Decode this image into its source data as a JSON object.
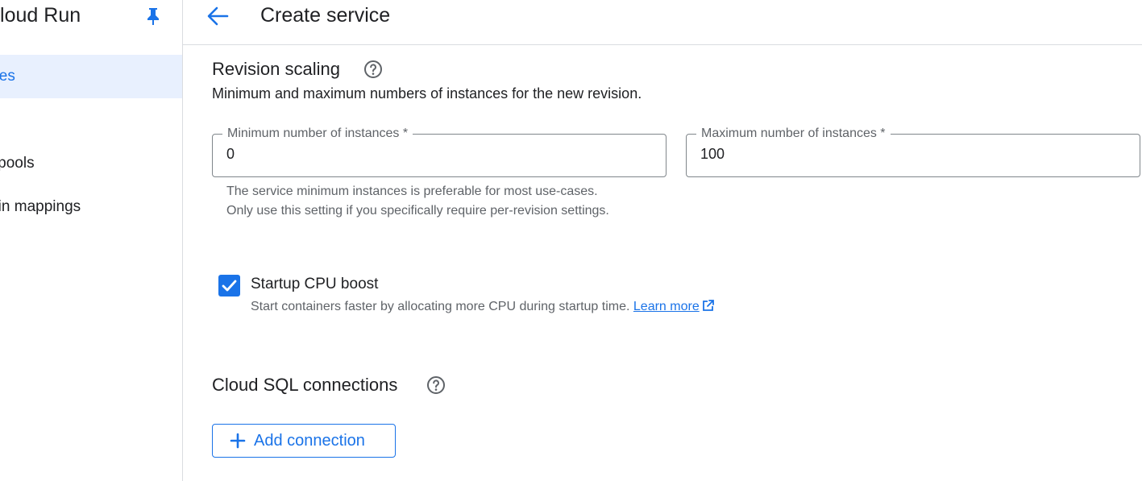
{
  "sidebar": {
    "title": "Cloud Run",
    "items": [
      {
        "label": "Services",
        "active": true
      },
      {
        "label": "Worker pools",
        "active": false
      },
      {
        "label": "Domain mappings",
        "active": false
      }
    ]
  },
  "header": {
    "title": "Create service"
  },
  "revision_scaling": {
    "title": "Revision scaling",
    "description": "Minimum and maximum numbers of instances for the new revision.",
    "min_field": {
      "label": "Minimum number of instances *",
      "value": "0"
    },
    "max_field": {
      "label": "Maximum number of instances *",
      "value": "100"
    },
    "hint": "The service minimum instances is preferable for most use-cases. Only use this setting if you specifically require per-revision settings."
  },
  "startup_cpu_boost": {
    "label": "Startup CPU boost",
    "checked": true,
    "description": "Start containers faster by allocating more CPU during startup time.",
    "link_label": "Learn more"
  },
  "cloud_sql": {
    "title": "Cloud SQL connections",
    "add_button_label": "Add connection"
  },
  "colors": {
    "accent": "#1a73e8",
    "active_nav_bg": "#e8f0fe",
    "border": "#dadce0"
  },
  "icons": [
    "pin-icon",
    "arrow-back-icon",
    "help-icon",
    "checkmark-icon",
    "external-link-icon",
    "plus-icon"
  ]
}
